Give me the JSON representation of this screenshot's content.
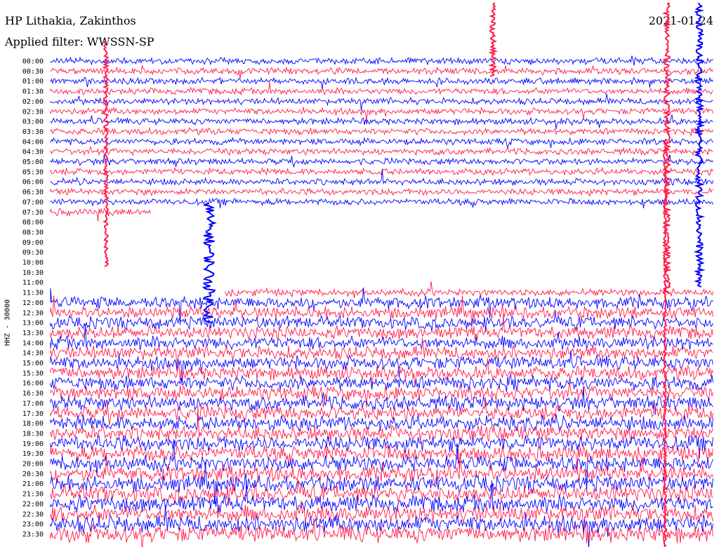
{
  "header": {
    "station": "HP Lithakia, Zakinthos",
    "filter": "Applied filter: WWSSN-SP",
    "date": "2021-01-24"
  },
  "chart_data": {
    "type": "line",
    "title": "HP Lithakia, Zakinthos",
    "subtitle": "Applied filter: WWSSN-SP",
    "ylabel": "HHZ - 30000",
    "date": "2021-01-24",
    "y_ticks": [
      "00:00",
      "00:30",
      "01:00",
      "01:30",
      "02:00",
      "02:30",
      "03:00",
      "03:30",
      "04:00",
      "04:30",
      "05:00",
      "05:30",
      "06:00",
      "06:30",
      "07:00",
      "07:30",
      "08:00",
      "08:30",
      "09:00",
      "09:30",
      "10:00",
      "10:30",
      "11:00",
      "11:30",
      "12:00",
      "12:30",
      "13:00",
      "13:30",
      "14:00",
      "14:30",
      "15:00",
      "15:30",
      "16:00",
      "16:30",
      "17:00",
      "17:30",
      "18:00",
      "18:30",
      "19:00",
      "19:30",
      "20:00",
      "20:30",
      "21:00",
      "21:30",
      "22:00",
      "22:30",
      "23:00",
      "23:30"
    ],
    "x_range_minutes": [
      0,
      30
    ],
    "series": [
      {
        "color": "#0000ff"
      },
      {
        "color": "#ff1a4a"
      }
    ],
    "data_gaps": [
      {
        "start": "07:30",
        "end": "11:30",
        "note_value": "no signal"
      }
    ]
  }
}
